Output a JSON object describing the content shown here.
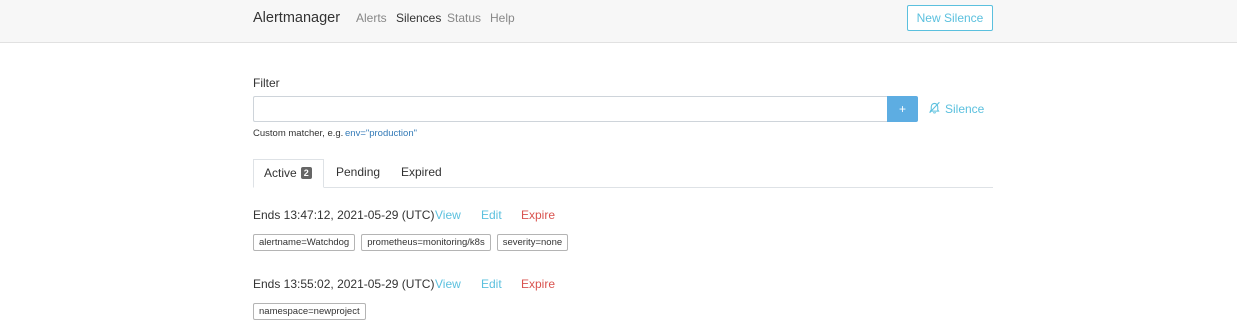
{
  "navbar": {
    "brand": "Alertmanager",
    "links": [
      "Alerts",
      "Silences",
      "Status",
      "Help"
    ],
    "active_link": "Silences",
    "new_silence_label": "New Silence"
  },
  "filter": {
    "label": "Filter",
    "value": "",
    "placeholder": "",
    "add_label": "+",
    "silence_label": "Silence",
    "hint_text": "Custom matcher, e.g.",
    "hint_example": "env=\"production\""
  },
  "tabs": [
    {
      "label": "Active",
      "count": "2",
      "active": true
    },
    {
      "label": "Pending"
    },
    {
      "label": "Expired"
    }
  ],
  "silences": [
    {
      "ends": "Ends 13:47:12, 2021-05-29 (UTC)",
      "actions": {
        "view": "View",
        "edit": "Edit",
        "expire": "Expire"
      },
      "matchers": [
        "alertname=Watchdog",
        "prometheus=monitoring/k8s",
        "severity=none"
      ]
    },
    {
      "ends": "Ends 13:55:02, 2021-05-29 (UTC)",
      "actions": {
        "view": "View",
        "edit": "Edit",
        "expire": "Expire"
      },
      "matchers": [
        "namespace=newproject"
      ]
    }
  ],
  "colors": {
    "accent": "#5bc0de",
    "danger": "#d9534f",
    "primary_button": "#5dade2"
  }
}
